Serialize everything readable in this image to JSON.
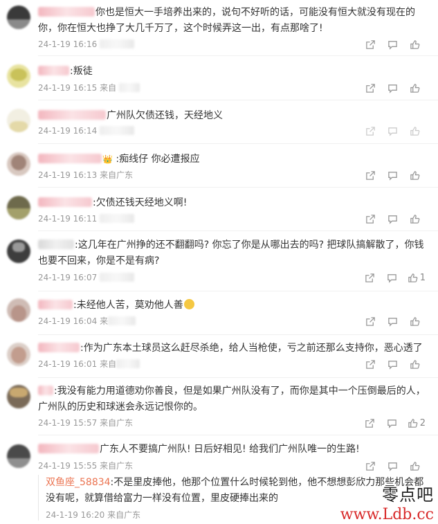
{
  "comments": [
    {
      "text": "你也是恒大一手培养出来的，说句不好听的话，可能没有恒大就没有现在的你，你在恒大也挣了大几千万了，这个时候弄这一出，有点那啥了!",
      "time": "24-1-19 16:16",
      "source": "",
      "likes": ""
    },
    {
      "text": "叛徒",
      "time": "24-1-19 16:15",
      "source": "来自",
      "likes": ""
    },
    {
      "text": "广州队欠债还钱，天经地义",
      "time": "24-1-19 16:14",
      "source": "",
      "likes": ""
    },
    {
      "text": "痴线仔 你必遭报应",
      "time": "24-1-19 16:13",
      "source": "来自广东",
      "likes": ""
    },
    {
      "text": "欠债还钱天经地义啊!",
      "time": "24-1-19 16:11",
      "source": "",
      "likes": ""
    },
    {
      "text": "这几年在广州挣的还不翻翻吗? 你忘了你是从哪出去的吗? 把球队搞解散了，你钱也要不回来，你是不是有病?",
      "time": "24-1-19 16:07",
      "source": "",
      "likes": "1"
    },
    {
      "text_before": "未经他人苦，莫劝他人善",
      "time": "24-1-19 16:04",
      "source": "来",
      "likes": ""
    },
    {
      "text": "作为广东本土球员这么赶尽杀绝，给人当枪使，亏之前还那么支持你，恶心透了",
      "time": "24-1-19 16:01",
      "source": "来自",
      "likes": ""
    },
    {
      "text": "我没有能力用道德劝你善良，但是如果广州队没有了，而你是其中一个压倒最后的人，广州队的历史和球迷会永远记恨你的。",
      "time": "24-1-19 15:57",
      "source": "来自广东",
      "likes": "2"
    },
    {
      "text": "广东人不要搞广州队! 日后好相见! 给我们广州队唯一的生路!",
      "time": "24-1-19 15:55",
      "source": "来自广东",
      "likes": ""
    }
  ],
  "reply": {
    "name": "双鱼座_58834",
    "text": ":不是里皮捧他，他那个位置什么时候轮到他，他不想想彭欣力那些机会都没有呢，就算借给富力一样没有位置，里皮硬捧出来的",
    "time": "24-1-19 16:20",
    "source": "来自广东"
  },
  "watermark": {
    "line1": "零点吧",
    "line2": "www.Ldb.cc"
  },
  "icons": [
    "share-icon",
    "comment-icon",
    "like-icon"
  ]
}
